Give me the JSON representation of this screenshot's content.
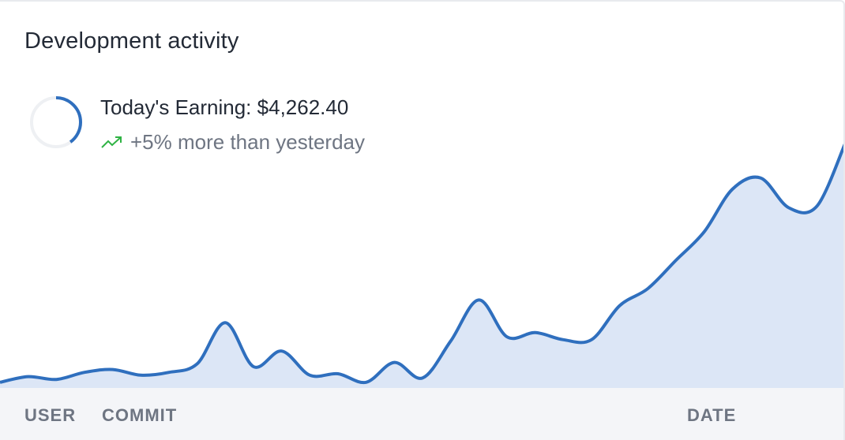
{
  "card": {
    "title": "Development activity"
  },
  "stat": {
    "earning_label": "Today's Earning:",
    "earning_value": "$4,262.40",
    "delta_text": "+5% more than yesterday",
    "trend_icon": "trending-up-icon",
    "ring_progress": 0.4
  },
  "colors": {
    "line": "#2f6fbe",
    "area": "#dce6f6",
    "trend_up": "#2fb344",
    "ring_track": "#eef0f3"
  },
  "chart_data": {
    "type": "area",
    "series": [
      {
        "values": [
          2,
          4,
          3,
          5.5,
          6.5,
          4.5,
          5.5,
          8.5,
          23,
          7.5,
          13,
          4.5,
          5,
          2,
          9,
          3.5,
          16.5,
          31,
          18,
          19.5,
          17,
          17,
          29,
          35,
          45,
          55,
          70,
          74,
          63.5,
          64,
          86
        ]
      }
    ],
    "ylim": [
      0,
      100
    ]
  },
  "table": {
    "columns": [
      "USER",
      "COMMIT",
      "DATE"
    ]
  }
}
